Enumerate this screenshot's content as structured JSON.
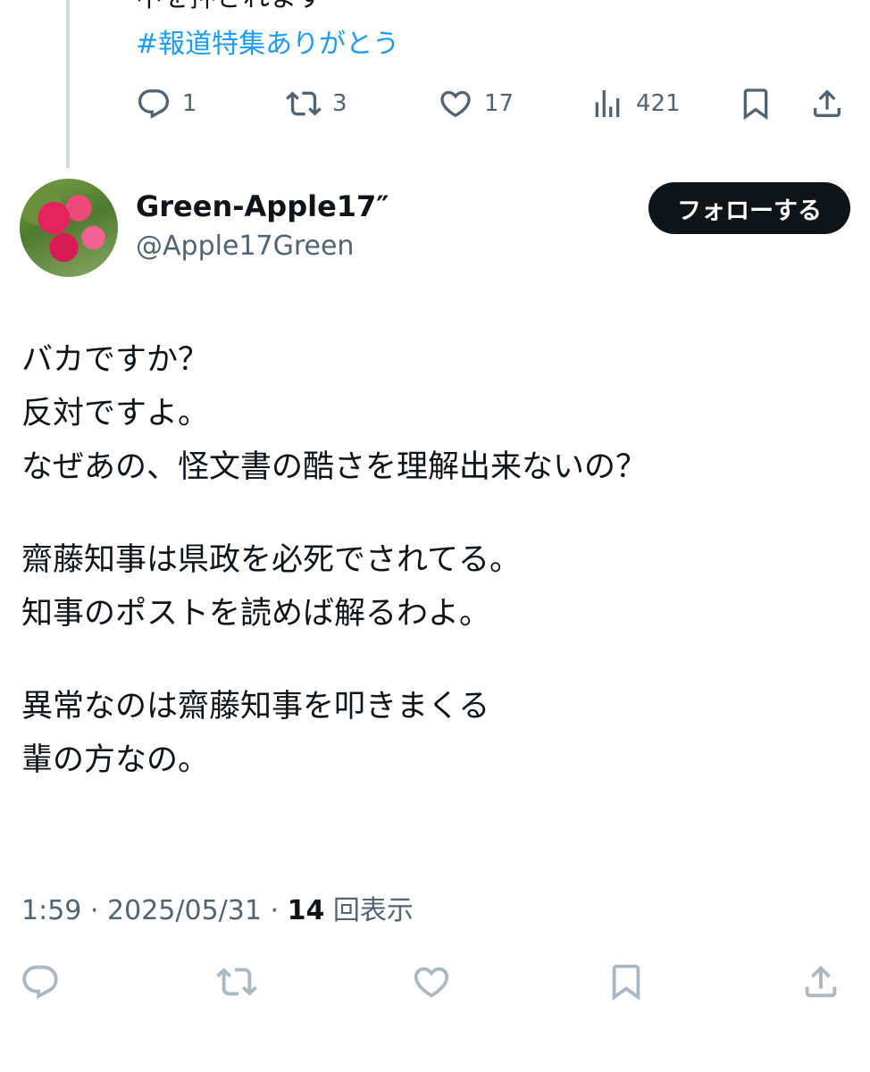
{
  "parent_post": {
    "text_cut": "中を押されます",
    "hashtag": "#報道特集ありがとう",
    "actions": {
      "reply_count": "1",
      "retweet_count": "3",
      "like_count": "17",
      "view_count": "421"
    }
  },
  "post": {
    "author_name": "Green-Apple17″",
    "author_handle": "@Apple17Green",
    "follow_label": "フォローする",
    "lines": [
      "バカですか？",
      "反対ですよ。",
      "なぜあの、怪文書の酷さを理解出来ないの？",
      "",
      "齋藤知事は県政を必死でされてる。",
      "知事のポストを読めば解るわよ。",
      "",
      "異常なのは齋藤知事を叩きまくる",
      "輩の方なの。"
    ],
    "time": "1:59",
    "date": "2025/05/31",
    "separator": "·",
    "views_count": "14",
    "views_label": "回表示"
  },
  "colors": {
    "text": "#0f1419",
    "secondary": "#536471",
    "link": "#1d9bf0",
    "thread_line": "#cfd9de",
    "inactive_icon": "#aab8c2"
  }
}
